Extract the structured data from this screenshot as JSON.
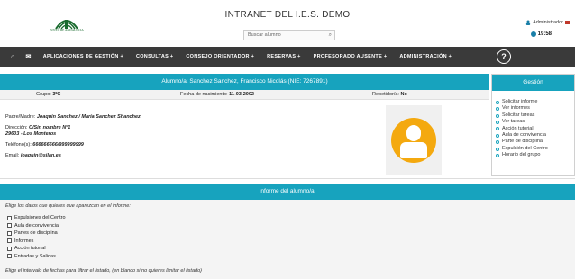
{
  "header": {
    "title": "INTRANET DEL I.E.S. DEMO",
    "logo_text": "JUNTA DE ANDALUCIA",
    "search_placeholder": "Buscar alumno",
    "user": "Administrador",
    "time": "19:58"
  },
  "nav": {
    "home_icon": "home-icon",
    "mail_icon": "mail-icon",
    "items": [
      "APLICACIONES DE GESTIÓN +",
      "CONSULTAS +",
      "CONSEJO ORIENTADOR +",
      "RESERVAS +",
      "PROFESORADO AUSENTE +",
      "ADMINISTRACIÓN +"
    ],
    "help": "?"
  },
  "student": {
    "heading": "Alumno/a: Sanchez Sanchez, Francisco Nicolás (NIE: 7267891)",
    "grupo_label": "Grupo:",
    "grupo_value": "3ºC",
    "nacimiento_label": "Fecha de nacimiento:",
    "nacimiento_value": "11-03-2002",
    "repetidor_label": "Repetidor/a:",
    "repetidor_value": "No",
    "padres_label": "Padre/Madre:",
    "padres_value": "Joaquín Sanchez / María Sanchez Shanchez",
    "direccion_label": "Dirección:",
    "direccion_line1": "C/Sin nombre Nº1",
    "direccion_line2": "29603 - Los Monteros",
    "telefono_label": "Teléfono(s):",
    "telefono_value": "666666666/999999999",
    "email_label": "Email:",
    "email_value": "joaquin@silan.es"
  },
  "gestion": {
    "heading": "Gestión",
    "items": [
      "Solicitar informe",
      "Ver informes",
      "Solicitar tareas",
      "Ver tareas",
      "Acción tutorial",
      "Aula de convivencia",
      "Parte de disciplina",
      "Expulsión del Centro",
      "Horario del grupo"
    ]
  },
  "report": {
    "heading": "Informe del alumno/a.",
    "hint1": "Elige los datos que quieres que aparezcan en el informe:",
    "checks": [
      "Expulsiones del Centro",
      "Aula de convivencia",
      "Partes de disciplina",
      "Informes",
      "Acción tutorial",
      "Entradas y Salidas"
    ],
    "hint2": "Elige el intervalo de fechas para filtrar el listado, (en blanco si no quieres limitar el listado)"
  },
  "colors": {
    "accent": "#17a3be",
    "nav": "#3a3a3a",
    "avatar": "#f4a90f"
  }
}
